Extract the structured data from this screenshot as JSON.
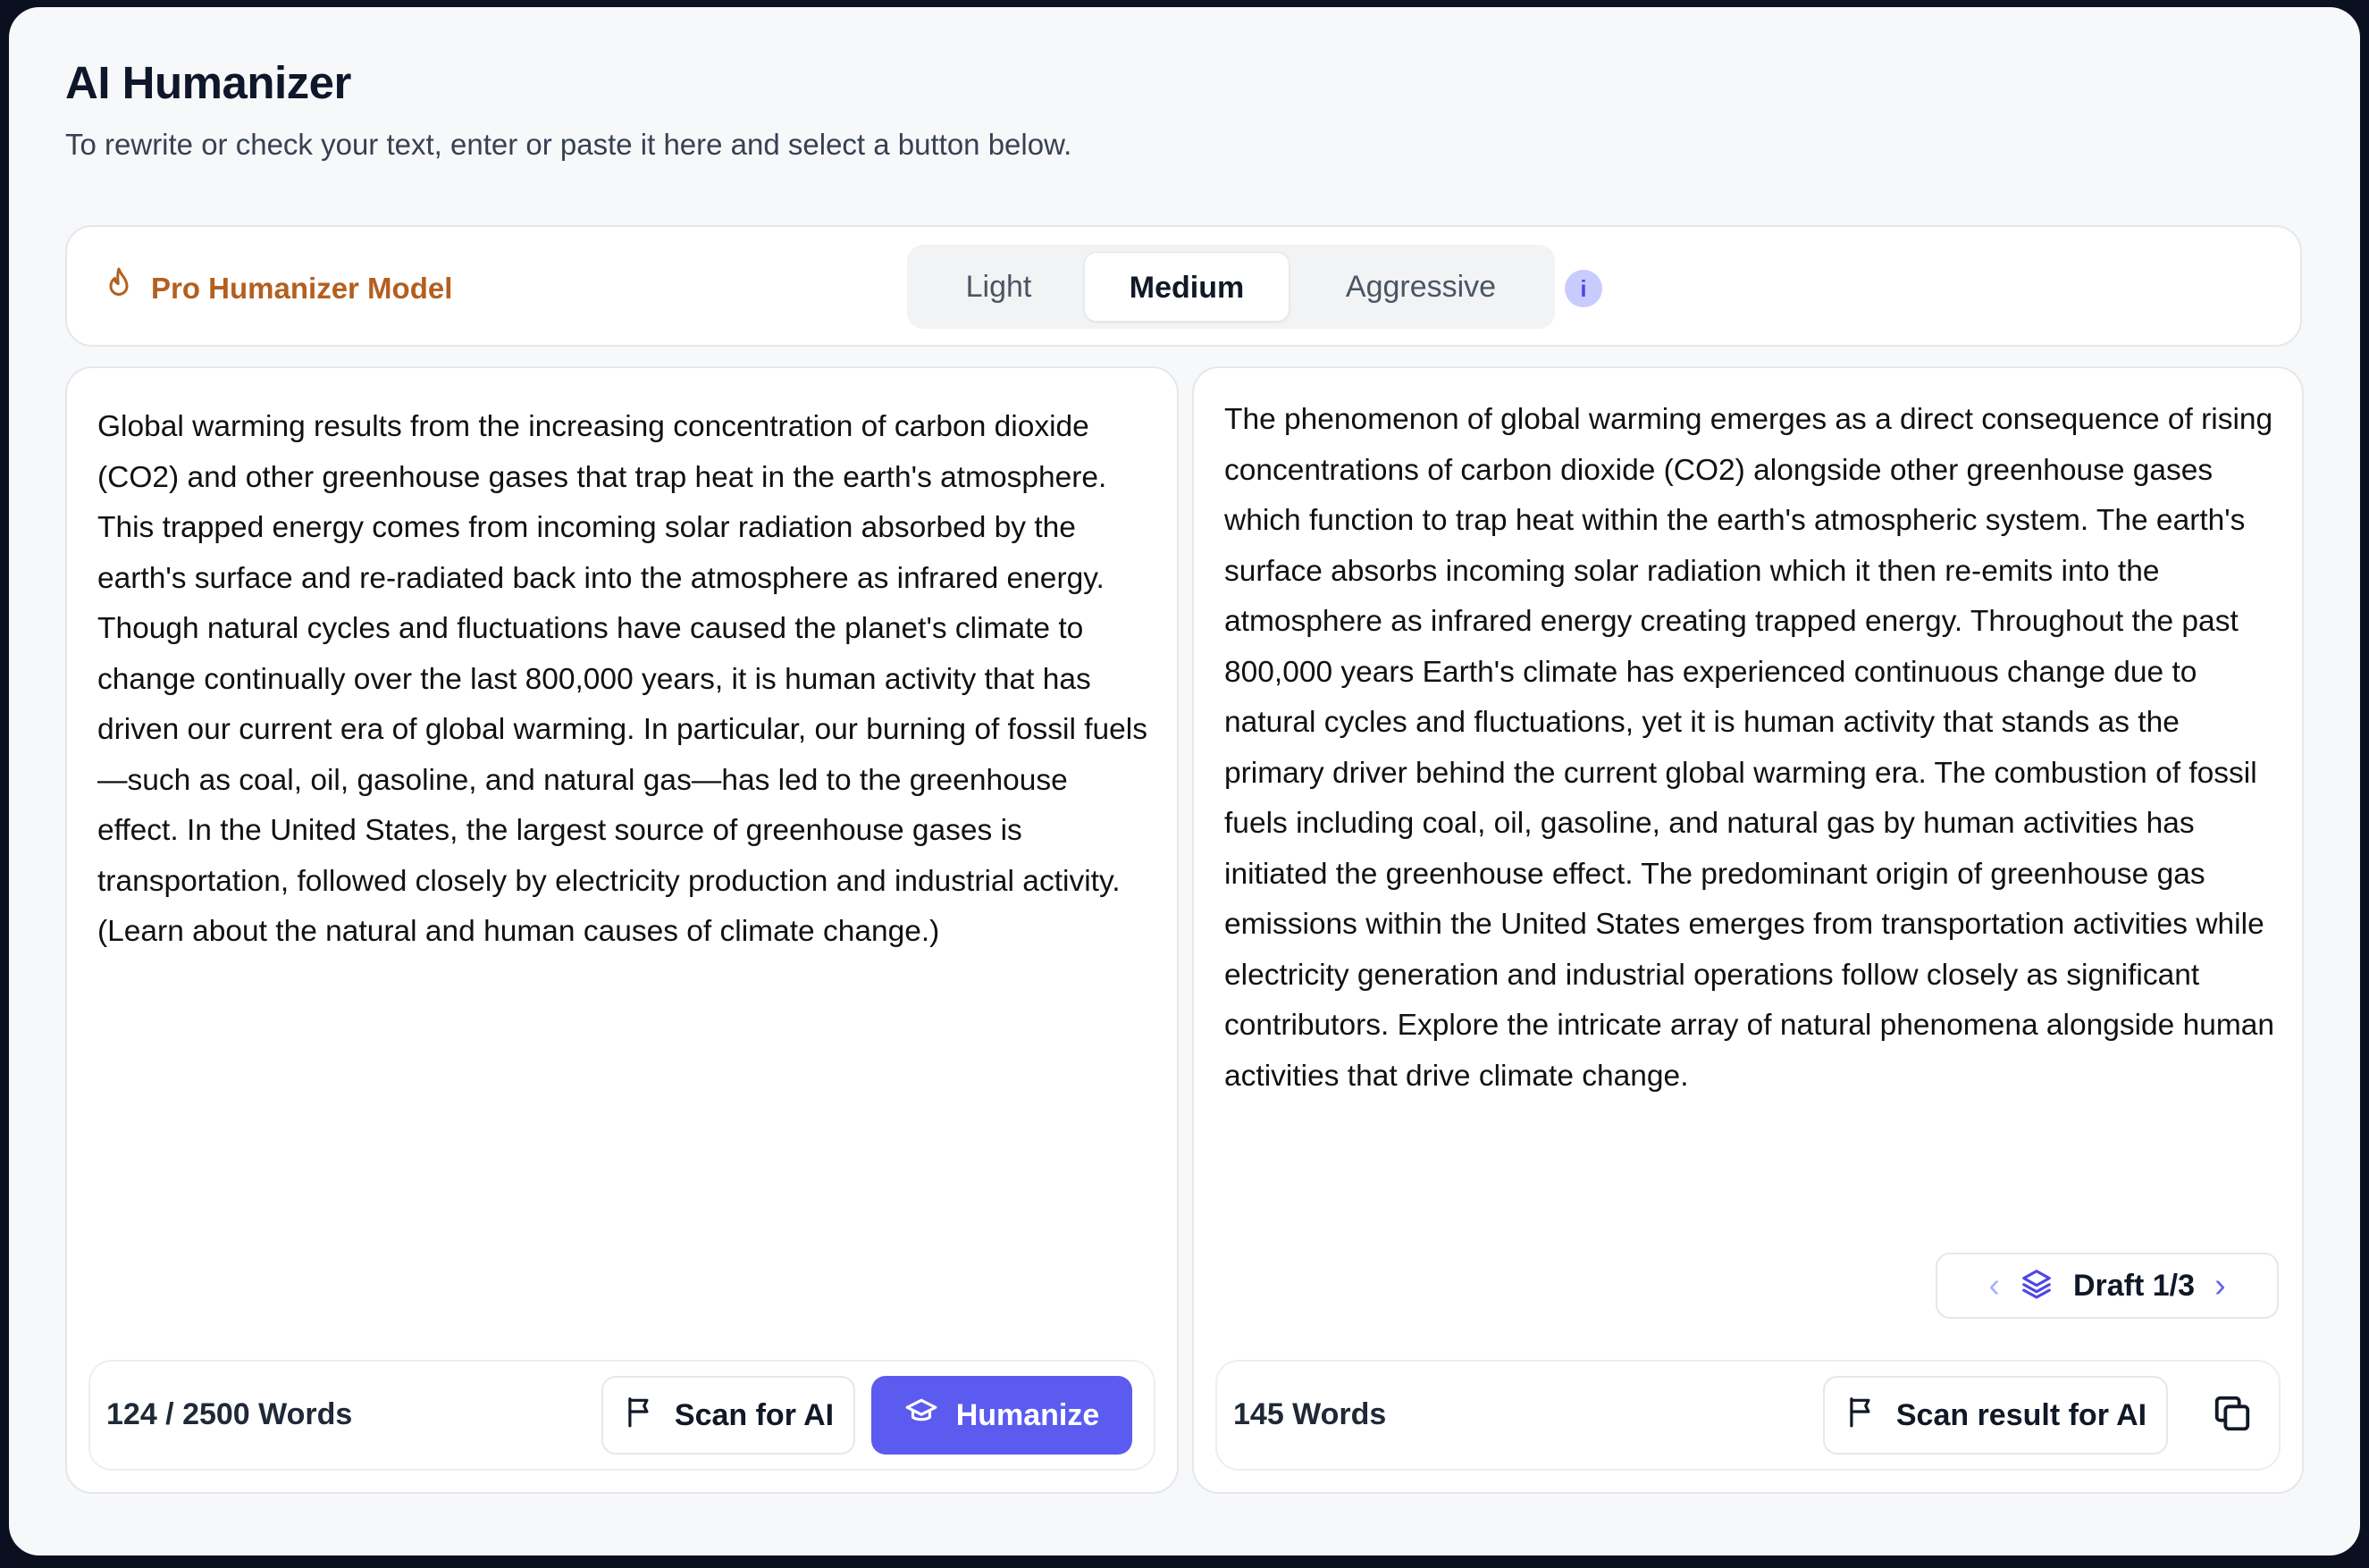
{
  "header": {
    "title": "AI Humanizer",
    "subtitle": "To rewrite or check your text, enter or paste it here and select a button below."
  },
  "model_bar": {
    "model_label": "Pro Humanizer Model",
    "model_icon": "flame-icon",
    "modes": [
      "Light",
      "Medium",
      "Aggressive"
    ],
    "selected_mode": "Medium",
    "info_glyph": "i"
  },
  "input_panel": {
    "text": "Global warming results from the increasing concentration of carbon dioxide (CO2) and other greenhouse gases that trap heat in the earth's atmosphere. This trapped energy comes from incoming solar radiation absorbed by the earth's surface and re-radiated back into the atmosphere as infrared energy. Though natural cycles and fluctuations have caused the planet's climate to change continually over the last 800,000 years, it is human activity that has driven our current era of global warming. In particular, our burning of fossil fuels—such as coal, oil, gasoline, and natural gas—has led to the greenhouse effect. In the United States, the largest source of greenhouse gases is transportation, followed closely by electricity production and industrial activity. (Learn about the natural and human causes of climate change.)",
    "word_count": "124 / 2500 Words",
    "scan_label": "Scan for AI",
    "humanize_label": "Humanize"
  },
  "output_panel": {
    "text": "The phenomenon of global warming emerges as a direct consequence of rising concentrations of carbon dioxide (CO2) alongside other greenhouse gases which function to trap heat within the earth's atmospheric system. The earth's surface absorbs incoming solar radiation which it then re-emits into the atmosphere as infrared energy creating trapped energy. Throughout the past 800,000 years Earth's climate has experienced continuous change due to natural cycles and fluctuations, yet it is human activity that stands as the primary driver behind the current global warming era. The combustion of fossil fuels including coal, oil, gasoline, and natural gas by human activities has initiated the greenhouse effect. The predominant origin of greenhouse gas emissions within the United States emerges from transportation activities while electricity generation and industrial operations follow closely as significant contributors. Explore the intricate array of natural phenomena alongside human activities that drive climate change.",
    "draft_label": "Draft 1/3",
    "word_count": "145 Words",
    "scan_result_label": "Scan result for AI"
  },
  "colors": {
    "accent": "#5b5bf0",
    "model_label": "#b45f1f",
    "background": "#f7f8fa"
  }
}
